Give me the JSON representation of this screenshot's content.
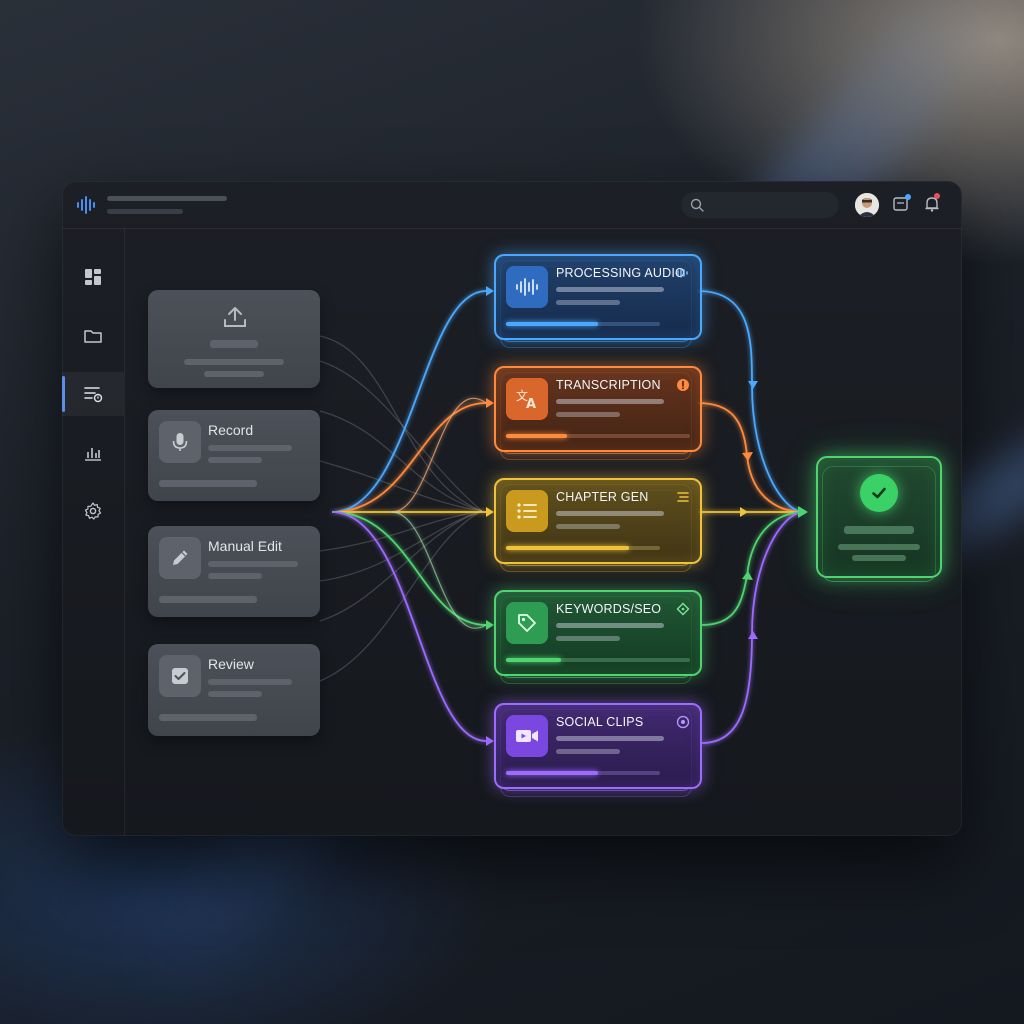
{
  "topbar": {
    "search": {
      "placeholder": ""
    },
    "notification_badge_color": "#e8505b",
    "messages_badge_color": "#4aa8ff"
  },
  "sidebar": {
    "items": [
      {
        "name": "dashboard",
        "icon": "dashboard-icon",
        "active": false
      },
      {
        "name": "files",
        "icon": "folder-icon",
        "active": false
      },
      {
        "name": "workflows",
        "icon": "workflow-list-icon",
        "active": true
      },
      {
        "name": "analytics",
        "icon": "bar-chart-icon",
        "active": false
      },
      {
        "name": "settings",
        "icon": "gear-icon",
        "active": false
      }
    ]
  },
  "sources": [
    {
      "id": "upload",
      "label": "",
      "icon": "upload-icon"
    },
    {
      "id": "record",
      "label": "Record",
      "icon": "microphone-icon"
    },
    {
      "id": "manual_edit",
      "label": "Manual Edit",
      "icon": "pencil-icon"
    },
    {
      "id": "review",
      "label": "Review",
      "icon": "checkbox-icon"
    }
  ],
  "steps": [
    {
      "id": "processing_audio",
      "title": "PROCESSING AUDIO",
      "icon": "waveform-icon",
      "color": "#4aa8ff",
      "progress": 0.6
    },
    {
      "id": "transcription",
      "title": "TRANSCRIPTION",
      "icon": "translate-icon",
      "color": "#ff8a3d",
      "progress": 0.33
    },
    {
      "id": "chapter_gen",
      "title": "CHAPTER GEN",
      "icon": "list-icon",
      "color": "#f0c23b",
      "progress": 0.8
    },
    {
      "id": "keywords_seo",
      "title": "KEYWORDS/SEO",
      "icon": "tag-icon",
      "color": "#4fd470",
      "progress": 0.3
    },
    {
      "id": "social_clips",
      "title": "SOCIAL CLIPS",
      "icon": "video-icon",
      "color": "#9d6bff",
      "progress": 0.6
    }
  ],
  "output": {
    "icon": "check-circle-icon",
    "color": "#3ad167"
  }
}
